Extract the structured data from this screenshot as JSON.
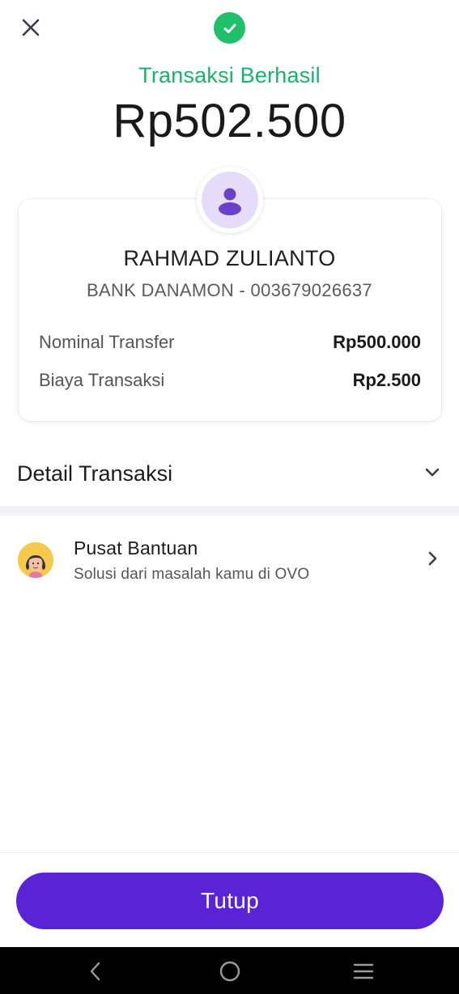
{
  "header": {
    "close_icon": "close-icon",
    "status_icon": "check-circle-icon",
    "status_text": "Transaksi Berhasil",
    "amount": "Rp502.500"
  },
  "recipient": {
    "avatar_icon": "person-icon",
    "name": "RAHMAD ZULIANTO",
    "bank_account": "BANK DANAMON - 003679026637"
  },
  "breakdown": [
    {
      "label": "Nominal Transfer",
      "value": "Rp500.000"
    },
    {
      "label": "Biaya Transaksi",
      "value": "Rp2.500"
    }
  ],
  "detail": {
    "title": "Detail Transaksi",
    "icon": "chevron-down-icon"
  },
  "help": {
    "title": "Pusat Bantuan",
    "subtitle": "Solusi dari masalah kamu di OVO",
    "icon": "chevron-right-icon"
  },
  "footer": {
    "close_label": "Tutup"
  },
  "navbar": {
    "back_icon": "back-icon",
    "home_icon": "home-icon",
    "recents_icon": "menu-icon"
  },
  "colors": {
    "success": "#1fbf6b",
    "primary": "#5a24d6",
    "avatar_bg": "#e6dcfa",
    "avatar_fg": "#6a3fc9"
  }
}
